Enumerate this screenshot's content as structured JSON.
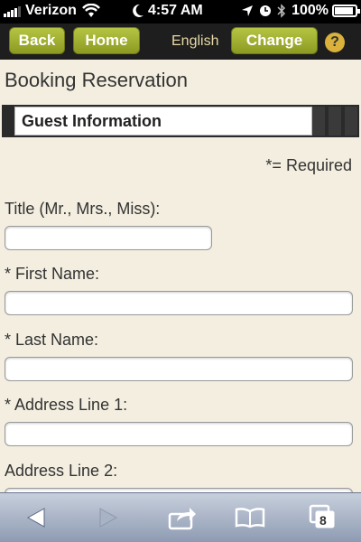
{
  "status_bar": {
    "carrier": "Verizon",
    "time": "4:57 AM",
    "battery": "100%"
  },
  "nav": {
    "back_label": "Back",
    "home_label": "Home",
    "language": "English",
    "change_label": "Change",
    "help_label": "?"
  },
  "page": {
    "title": "Booking Reservation",
    "section_title": "Guest Information",
    "required_note": "*= Required"
  },
  "form": {
    "fields": [
      {
        "label": "Title (Mr., Mrs., Miss):",
        "value": ""
      },
      {
        "label": "* First Name:",
        "value": ""
      },
      {
        "label": "* Last Name:",
        "value": ""
      },
      {
        "label": "* Address Line 1:",
        "value": ""
      },
      {
        "label": "Address Line 2:",
        "value": ""
      }
    ]
  },
  "toolbar": {
    "tabs_count": "8"
  },
  "colors": {
    "accent_green": "#9aab2c",
    "background": "#f3eee0",
    "nav_bg": "#1e1e1e"
  }
}
